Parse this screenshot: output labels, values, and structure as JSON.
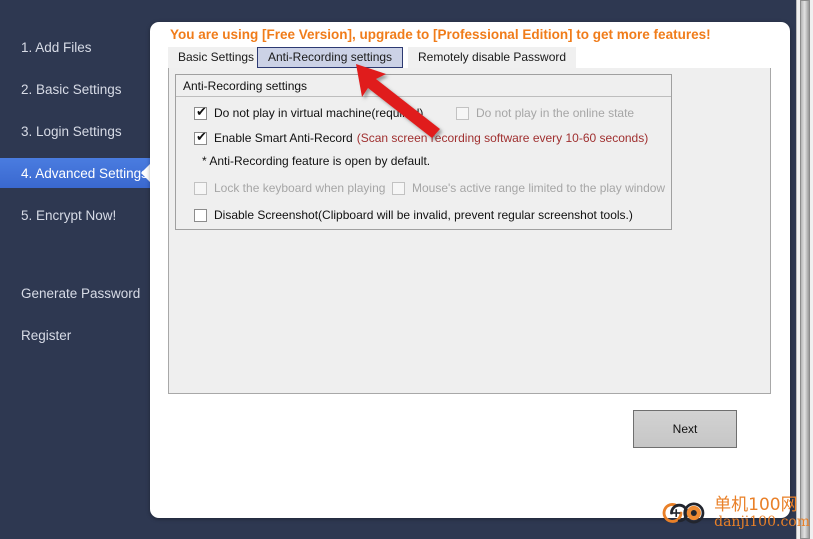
{
  "sidebar": {
    "items": [
      {
        "label": "1. Add Files",
        "active": false
      },
      {
        "label": "2. Basic Settings",
        "active": false
      },
      {
        "label": "3. Login Settings",
        "active": false
      },
      {
        "label": "4. Advanced Settings",
        "active": true
      },
      {
        "label": "5. Encrypt Now!",
        "active": false
      },
      {
        "label": "Generate Password",
        "active": false
      },
      {
        "label": "Register",
        "active": false
      }
    ]
  },
  "card": {
    "promo_text": "You are using [Free Version], upgrade to [Professional Edition] to get more features!",
    "promo_color": "#f07c1a"
  },
  "tabs": [
    {
      "label": "Basic Settings",
      "selected": false
    },
    {
      "label": "Anti-Recording settings",
      "selected": true
    },
    {
      "label": "Remotely disable Password",
      "selected": false
    }
  ],
  "groupbox": {
    "title": "Anti-Recording settings",
    "checkboxes": [
      {
        "label": "Do not play in virtual machine(required)",
        "checked": true,
        "disabled": false,
        "note": ""
      },
      {
        "label": "Do not play in the online state",
        "checked": false,
        "disabled": true,
        "note": ""
      },
      {
        "label": "Enable Smart Anti-Record",
        "checked": true,
        "disabled": false,
        "note": "(Scan screen recording software every 10-60 seconds)"
      },
      {
        "label": "Lock the keyboard when playing",
        "checked": false,
        "disabled": true,
        "note": ""
      },
      {
        "label": "Mouse's active range limited to the play window",
        "checked": false,
        "disabled": true,
        "note": ""
      },
      {
        "label": "Disable Screenshot(Clipboard will be invalid, prevent regular screenshot tools.)",
        "checked": false,
        "disabled": false,
        "note": ""
      }
    ],
    "footnote": "* Anti-Recording feature is open by default.",
    "note_color": "#a03030"
  },
  "annotation": {
    "arrow_color": "#e01b1b"
  },
  "buttons": {
    "next_label": "Next"
  },
  "watermark": {
    "cn_text": "单机100网",
    "url_text": "danji100.com",
    "color": "#e98028"
  }
}
